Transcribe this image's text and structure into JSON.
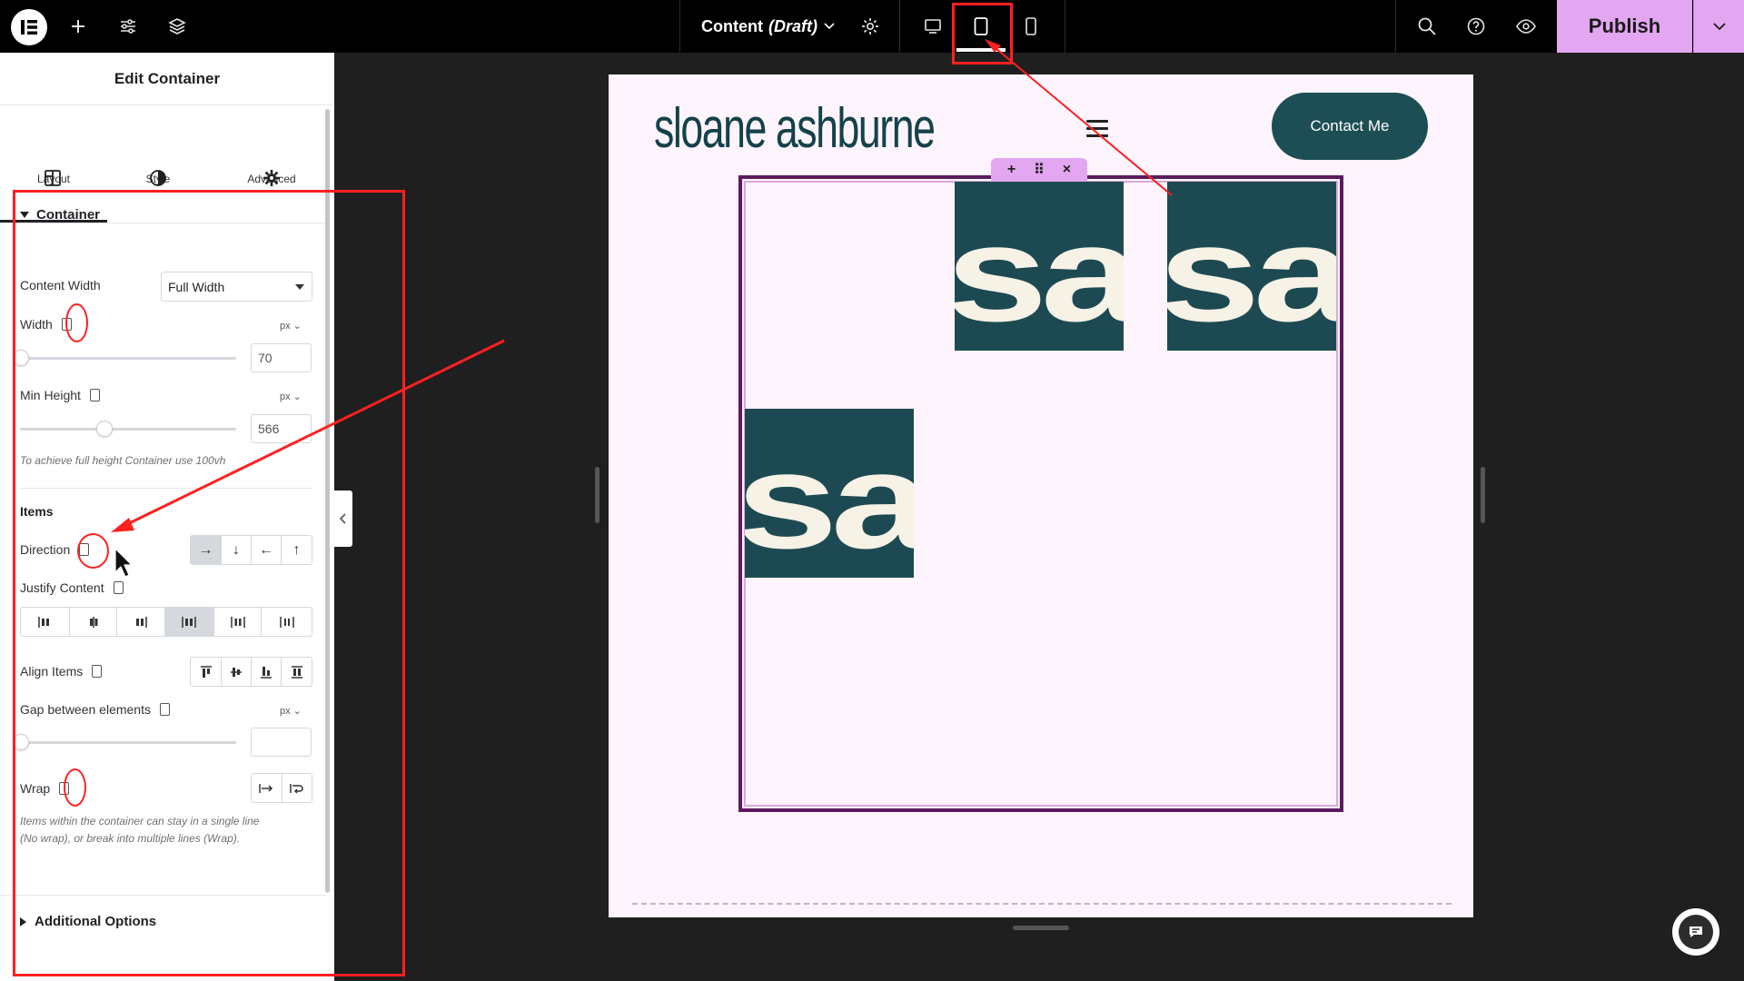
{
  "topbar": {
    "doc_title": "Content",
    "doc_status": "(Draft)",
    "publish_label": "Publish"
  },
  "panel": {
    "title": "Edit Container",
    "tabs": [
      {
        "label": "Layout",
        "icon": "layout-icon",
        "active": true
      },
      {
        "label": "Style",
        "icon": "style-icon"
      },
      {
        "label": "Advanced",
        "icon": "gear-icon"
      }
    ],
    "section_title": "Container",
    "content_width": {
      "label": "Content Width",
      "value": "Full Width"
    },
    "width": {
      "label": "Width",
      "unit": "px",
      "value": "70"
    },
    "min_height": {
      "label": "Min Height",
      "unit": "px",
      "value": "566",
      "note": "To achieve full height Container use 100vh"
    },
    "items_heading": "Items",
    "direction": {
      "label": "Direction",
      "options": [
        "→",
        "↓",
        "←",
        "↑"
      ],
      "active_index": 0
    },
    "justify": {
      "label": "Justify Content",
      "active_index": 3
    },
    "align": {
      "label": "Align Items"
    },
    "gap": {
      "label": "Gap between elements",
      "unit": "px",
      "value": ""
    },
    "wrap": {
      "label": "Wrap",
      "note_line1": "Items within the container can stay in a single line",
      "note_line2": "(No wrap), or break into multiple lines (Wrap)."
    },
    "additional": "Additional Options"
  },
  "preview": {
    "brand": "sloane ashburne",
    "contact_label": "Contact Me",
    "container_tools": [
      "+",
      "⠿",
      "×"
    ],
    "tile_text": "sa"
  },
  "colors": {
    "accent": "#e2a7f0",
    "brand_teal": "#1d4a52",
    "container_border": "#5b1b5e",
    "annotation_red": "#ff2020"
  }
}
